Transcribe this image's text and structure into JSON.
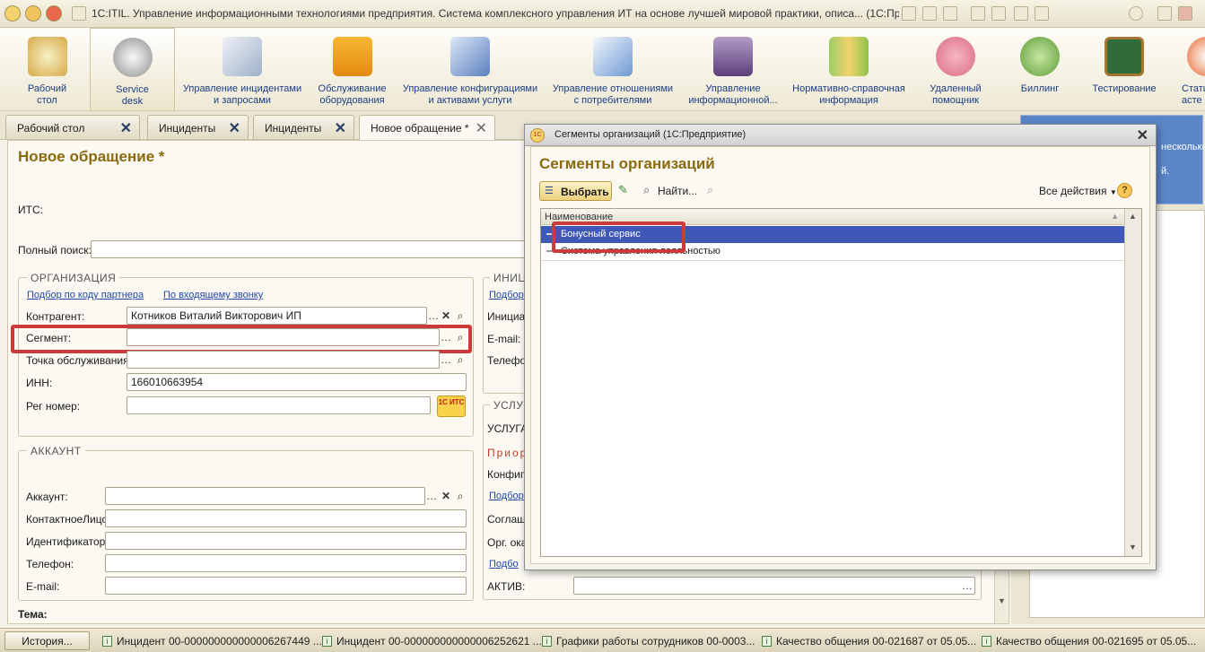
{
  "window": {
    "title": "1C:ITIL. Управление информационными технологиями предприятия. Система комплексного управления ИТ на основе лучшей мировой практики, описа... (1С:Предприятие)"
  },
  "sections": [
    {
      "label": "Рабочий\nстол",
      "icon": "desk-lamp-icon"
    },
    {
      "label": "Service\ndesk",
      "icon": "headset-icon"
    },
    {
      "label": "Управление инцидентами\nи запросами",
      "icon": "document-pencil-icon"
    },
    {
      "label": "Обслуживание\nоборудования",
      "icon": "truck-icon"
    },
    {
      "label": "Управление конфигурациями\nи активами услуги",
      "icon": "monitor-icon"
    },
    {
      "label": "Управление отношениями\nс потребителями",
      "icon": "chart-icon"
    },
    {
      "label": "Управление\nинформационной...",
      "icon": "lock-screen-icon"
    },
    {
      "label": "Нормативно-справочная\nинформация",
      "icon": "folders-icon"
    },
    {
      "label": "Удаленный\nпомощник",
      "icon": "character-icon"
    },
    {
      "label": "Биллинг",
      "icon": "character-icon"
    },
    {
      "label": "Тестирование",
      "icon": "blackboard-icon"
    },
    {
      "label": "Стати\nасте",
      "icon": "clock-icon"
    }
  ],
  "tabs": [
    {
      "label": "Рабочий стол"
    },
    {
      "label": "Инциденты"
    },
    {
      "label": "Инциденты"
    },
    {
      "label": "Новое обращение *"
    }
  ],
  "form": {
    "title": "Новое обращение *",
    "its_label": "ИТС:",
    "search_label": "Полный поиск:",
    "org_group": "ОРГАНИЗАЦИЯ",
    "link_partner": "Подбор по коду партнера",
    "link_call": "По входящему звонку",
    "contractor_label": "Контрагент:",
    "contractor_value": "Котников Виталий Викторович ИП",
    "segment_label": "Сегмент:",
    "service_point_label": "Точка обслуживания:",
    "inn_label": "ИНН:",
    "inn_value": "166010663954",
    "reg_label": "Рег номер:",
    "its_badge": "1С ИТС",
    "account_group": "АККАУНТ",
    "account_label": "Аккаунт:",
    "contact_label": "КонтактноеЛицо:",
    "ident_label": "Идентификатор:",
    "phone_label": "Телефон:",
    "email_label": "E-mail:",
    "theme_label": "Тема:",
    "init_group": "ИНИЦ",
    "init_link": "Подбор",
    "init_label": "Инициат",
    "init_email": "E-mail:",
    "init_phone": "Телефо",
    "service_group": "УСЛУ",
    "service_label": "УСЛУГА",
    "priority_label": "Приор",
    "config_label": "Конфигу",
    "select_link": "Подбор",
    "agreement_label": "Соглаш",
    "org_label": "Орг. ока",
    "select_link2": "Подбо",
    "active_label": "АКТИВ:"
  },
  "right_panel": {
    "text1": "несколько",
    "text2": "й."
  },
  "dialog": {
    "title": "Сегменты организаций  (1С:Предприятие)",
    "heading": "Сегменты организаций",
    "select_button": "Выбрать",
    "find_button": "Найти...",
    "all_actions": "Все действия",
    "column": "Наименование",
    "rows": [
      {
        "name": "Бонусный сервис",
        "selected": true
      },
      {
        "name": "Система управления лояльностью",
        "selected": false
      }
    ]
  },
  "taskbar": {
    "history": "История...",
    "items": [
      "Инцидент 00-000000000000006267449 ...",
      "Инцидент 00-000000000000006252621 ...",
      "Графики работы сотрудников 00-0003...",
      "Качество общения 00-021687 от 05.05...",
      "Качество общения 00-021695 от 05.05..."
    ]
  },
  "colors": {
    "accent_title": "#8a6a10",
    "highlight_red": "#cc3b3b",
    "selection_blue": "#3f58b8",
    "link_blue": "#1f48a8"
  }
}
